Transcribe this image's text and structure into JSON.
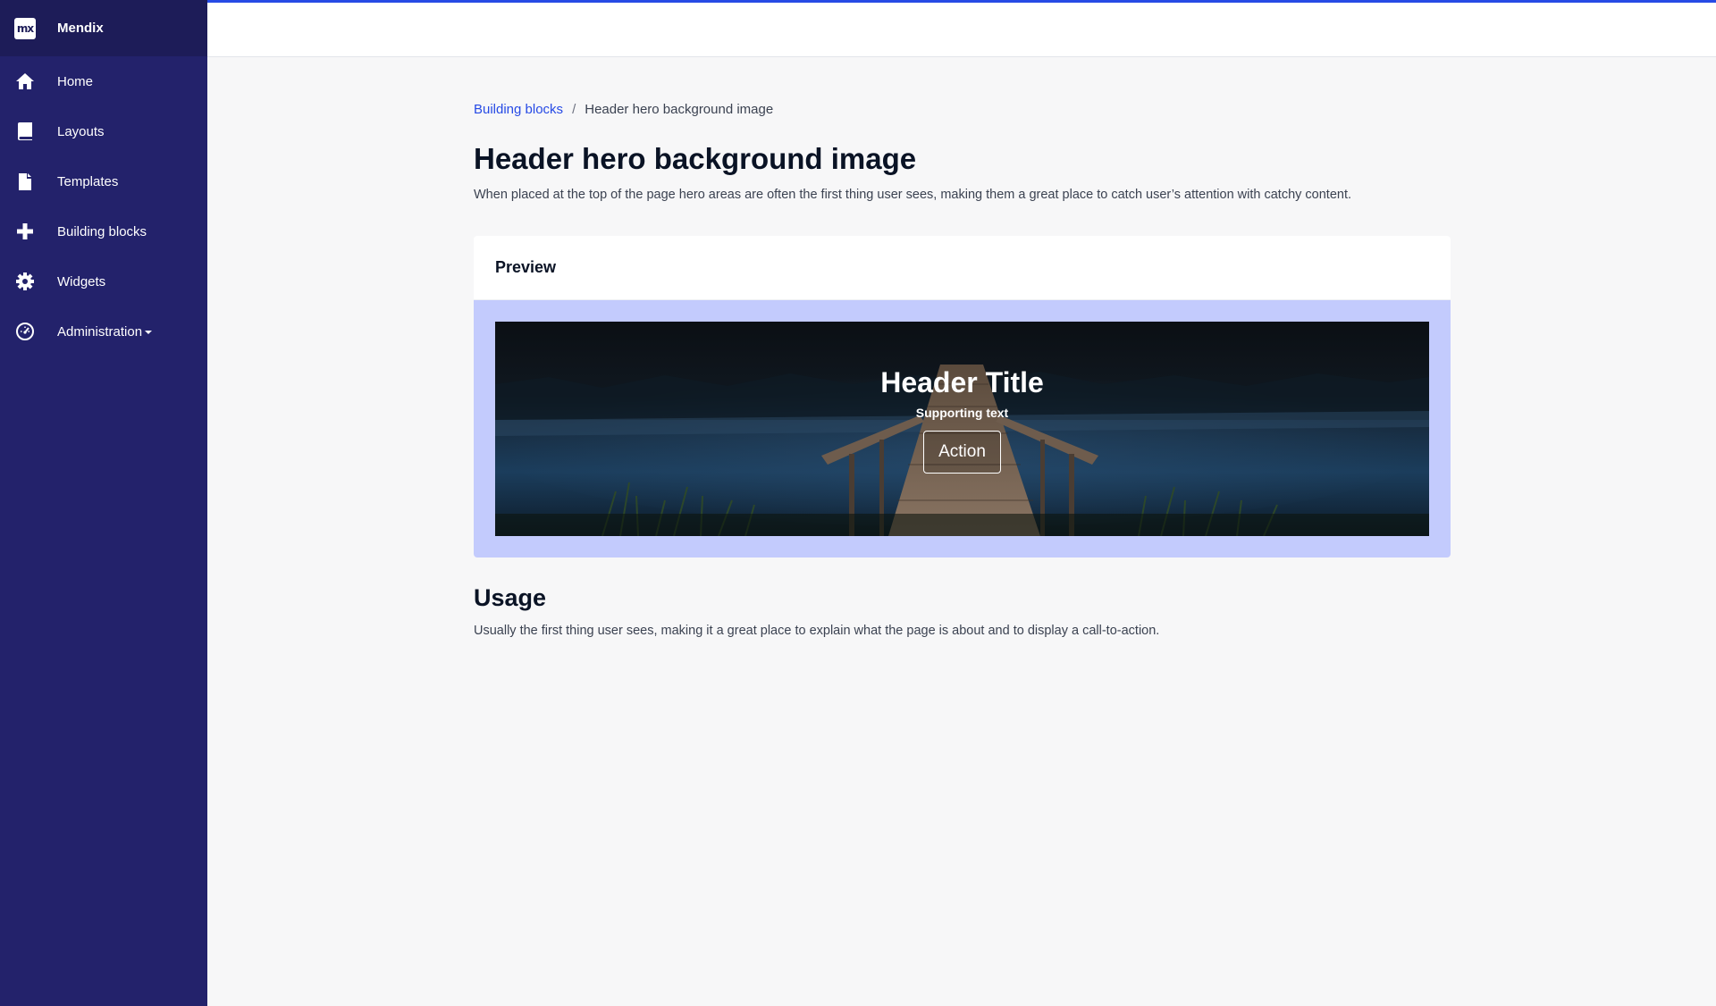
{
  "app": {
    "brand_logo": "mx",
    "brand_name": "Mendix"
  },
  "sidebar": {
    "items": [
      {
        "label": "Home",
        "icon": "home-icon"
      },
      {
        "label": "Layouts",
        "icon": "book-icon"
      },
      {
        "label": "Templates",
        "icon": "file-icon"
      },
      {
        "label": "Building blocks",
        "icon": "plus-icon"
      },
      {
        "label": "Widgets",
        "icon": "gear-icon"
      },
      {
        "label": "Administration",
        "icon": "dashboard-icon",
        "has_dropdown": true
      }
    ]
  },
  "breadcrumb": {
    "link": "Building blocks",
    "separator": "/",
    "current": "Header hero background image"
  },
  "page": {
    "title": "Header hero background image",
    "description": "When placed at the top of the page hero areas are often the first thing user sees, making them a great place to catch user’s attention with catchy content."
  },
  "preview": {
    "header": "Preview",
    "hero_title": "Header Title",
    "hero_subtitle": "Supporting text",
    "hero_button": "Action"
  },
  "usage": {
    "title": "Usage",
    "description": "Usually the first thing user sees, making it a great place to explain what the page is about and to display a call-to-action."
  },
  "colors": {
    "sidebar": "#23226b",
    "brand_bar": "#1d1c58",
    "accent": "#264ae5",
    "preview_bg": "#c3cbfd"
  }
}
